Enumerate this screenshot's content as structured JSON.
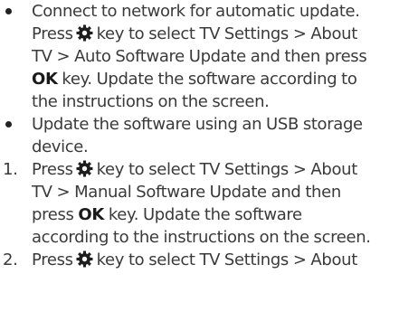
{
  "items": [
    {
      "marker": "bullet",
      "lines": [
        {
          "pre": "Connect to network for automatic update."
        },
        {
          "pre": "Press",
          "icon": "gear-icon",
          "post": "key to select TV Settings > About"
        },
        {
          "pre": "TV > Auto Software Update and then press"
        },
        {
          "bold": "OK",
          "post": " key. Update the software according to"
        },
        {
          "pre": "the instructions on the screen."
        }
      ]
    },
    {
      "marker": "bullet",
      "lines": [
        {
          "pre": "Update the software using an USB storage"
        },
        {
          "pre": "device."
        }
      ]
    },
    {
      "marker": "1.",
      "lines": [
        {
          "pre": "Press",
          "icon": "gear-icon",
          "post": "key to select TV Settings > About"
        },
        {
          "pre": "TV > Manual Software Update and then"
        },
        {
          "pre": "press ",
          "bold": "OK",
          "post": " key. Update the software"
        },
        {
          "pre": "according to the instructions on the screen."
        }
      ]
    },
    {
      "marker": "2.",
      "lines": [
        {
          "pre": "Press",
          "icon": "gear-icon",
          "post": "key to select TV Settings > About"
        }
      ]
    }
  ]
}
